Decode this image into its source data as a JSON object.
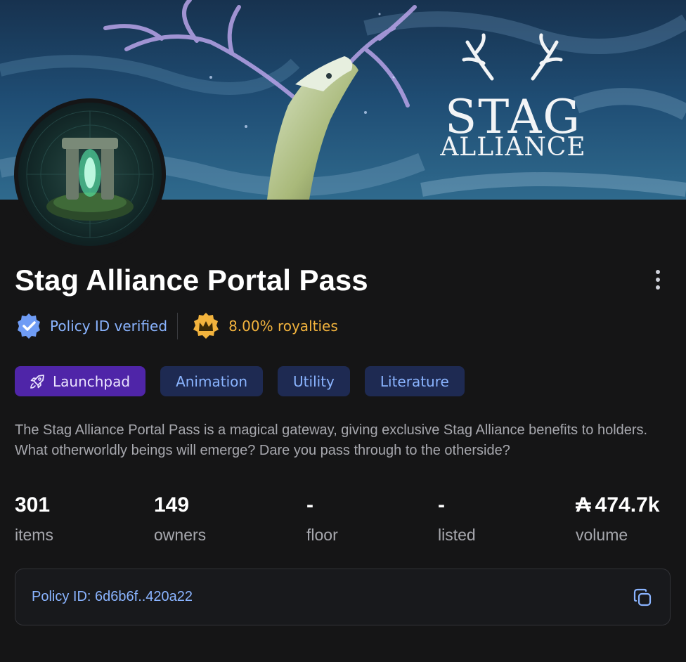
{
  "banner": {
    "logo_line1": "STAG",
    "logo_line2": "ALLIANCE"
  },
  "collection": {
    "title": "Stag Alliance Portal Pass",
    "verified_label": "Policy ID verified",
    "royalties_label": "8.00% royalties",
    "description": "The Stag Alliance Portal Pass is a magical gateway, giving exclusive Stag Alliance benefits to holders. What otherworldly beings will emerge? Dare you pass through to the otherside?"
  },
  "tags": [
    {
      "label": "Launchpad",
      "icon": "rocket-icon"
    },
    {
      "label": "Animation"
    },
    {
      "label": "Utility"
    },
    {
      "label": "Literature"
    }
  ],
  "stats": {
    "items": {
      "value": "301",
      "label": "items"
    },
    "owners": {
      "value": "149",
      "label": "owners"
    },
    "floor": {
      "value": "-",
      "label": "floor"
    },
    "listed": {
      "value": "-",
      "label": "listed"
    },
    "volume": {
      "value": "474.7k",
      "label": "volume",
      "currency_symbol": "₳"
    }
  },
  "policy": {
    "label": "Policy ID: 6d6b6f..420a22"
  },
  "colors": {
    "background": "#151516",
    "accent_blue": "#8ab4ff",
    "royalty_gold": "#f2b33d",
    "launchpad_purple": "#4f25a8",
    "tag_bg": "#1e2a52"
  }
}
